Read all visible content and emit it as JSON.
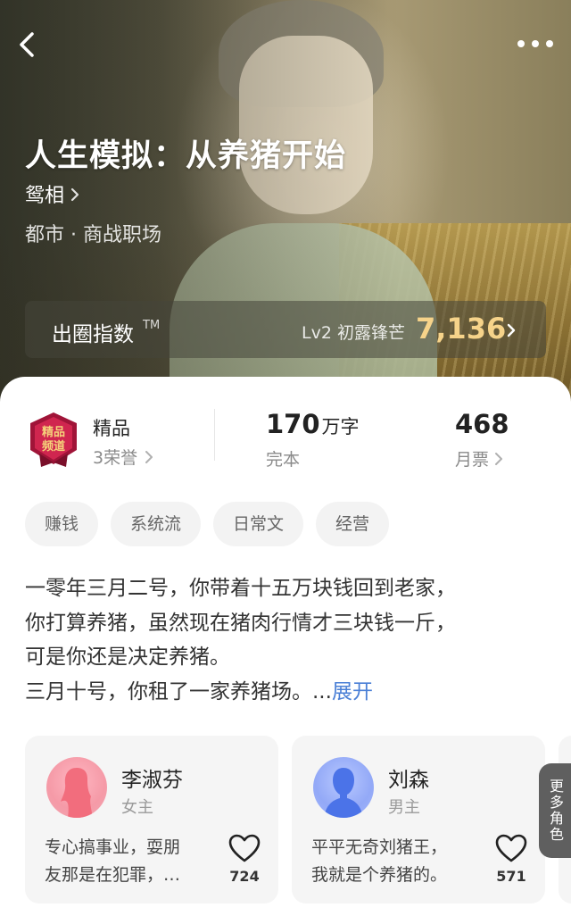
{
  "book": {
    "title": "人生模拟：从养猪开始",
    "author": "鸳相",
    "genre": "都市 · 商战职场"
  },
  "influence": {
    "label": "出圈指数",
    "tm": "TM",
    "level": "Lv2 初露锋芒",
    "score": "7,136",
    "score_color": "#f6d38a"
  },
  "stats": {
    "quality": "精品",
    "honor": "3荣誉",
    "badge_text": [
      "精品",
      "频道"
    ],
    "words_value": "170",
    "words_unit": "万字",
    "status": "完本",
    "tickets_value": "468",
    "tickets_label": "月票"
  },
  "tags": [
    "赚钱",
    "系统流",
    "日常文",
    "经营"
  ],
  "synopsis": {
    "lines": [
      "一零年三月二号，你带着十五万块钱回到老家，",
      "你打算养猪，虽然现在猪肉行情才三块钱一斤，",
      "可是你还是决定养猪。",
      "三月十号，你租了一家养猪场。..."
    ],
    "expand_label": "展开",
    "link_color": "#4a7fd6"
  },
  "characters": [
    {
      "name": "李淑芬",
      "role": "女主",
      "desc": [
        "专心搞事业，耍朋",
        "友那是在犯罪，…"
      ],
      "likes": "724",
      "avatar_color": "#f26d7d"
    },
    {
      "name": "刘森",
      "role": "男主",
      "desc": [
        "平平无奇刘猪王，",
        "我就是个养猪的。"
      ],
      "likes": "571",
      "avatar_color": "#4b73e8"
    }
  ],
  "more_roles_label": "更多角色",
  "icons": {
    "back": "back-arrow-icon",
    "more": "more-dots-icon",
    "chevron": "chevron-right-icon",
    "heart": "heart-outline-icon"
  }
}
